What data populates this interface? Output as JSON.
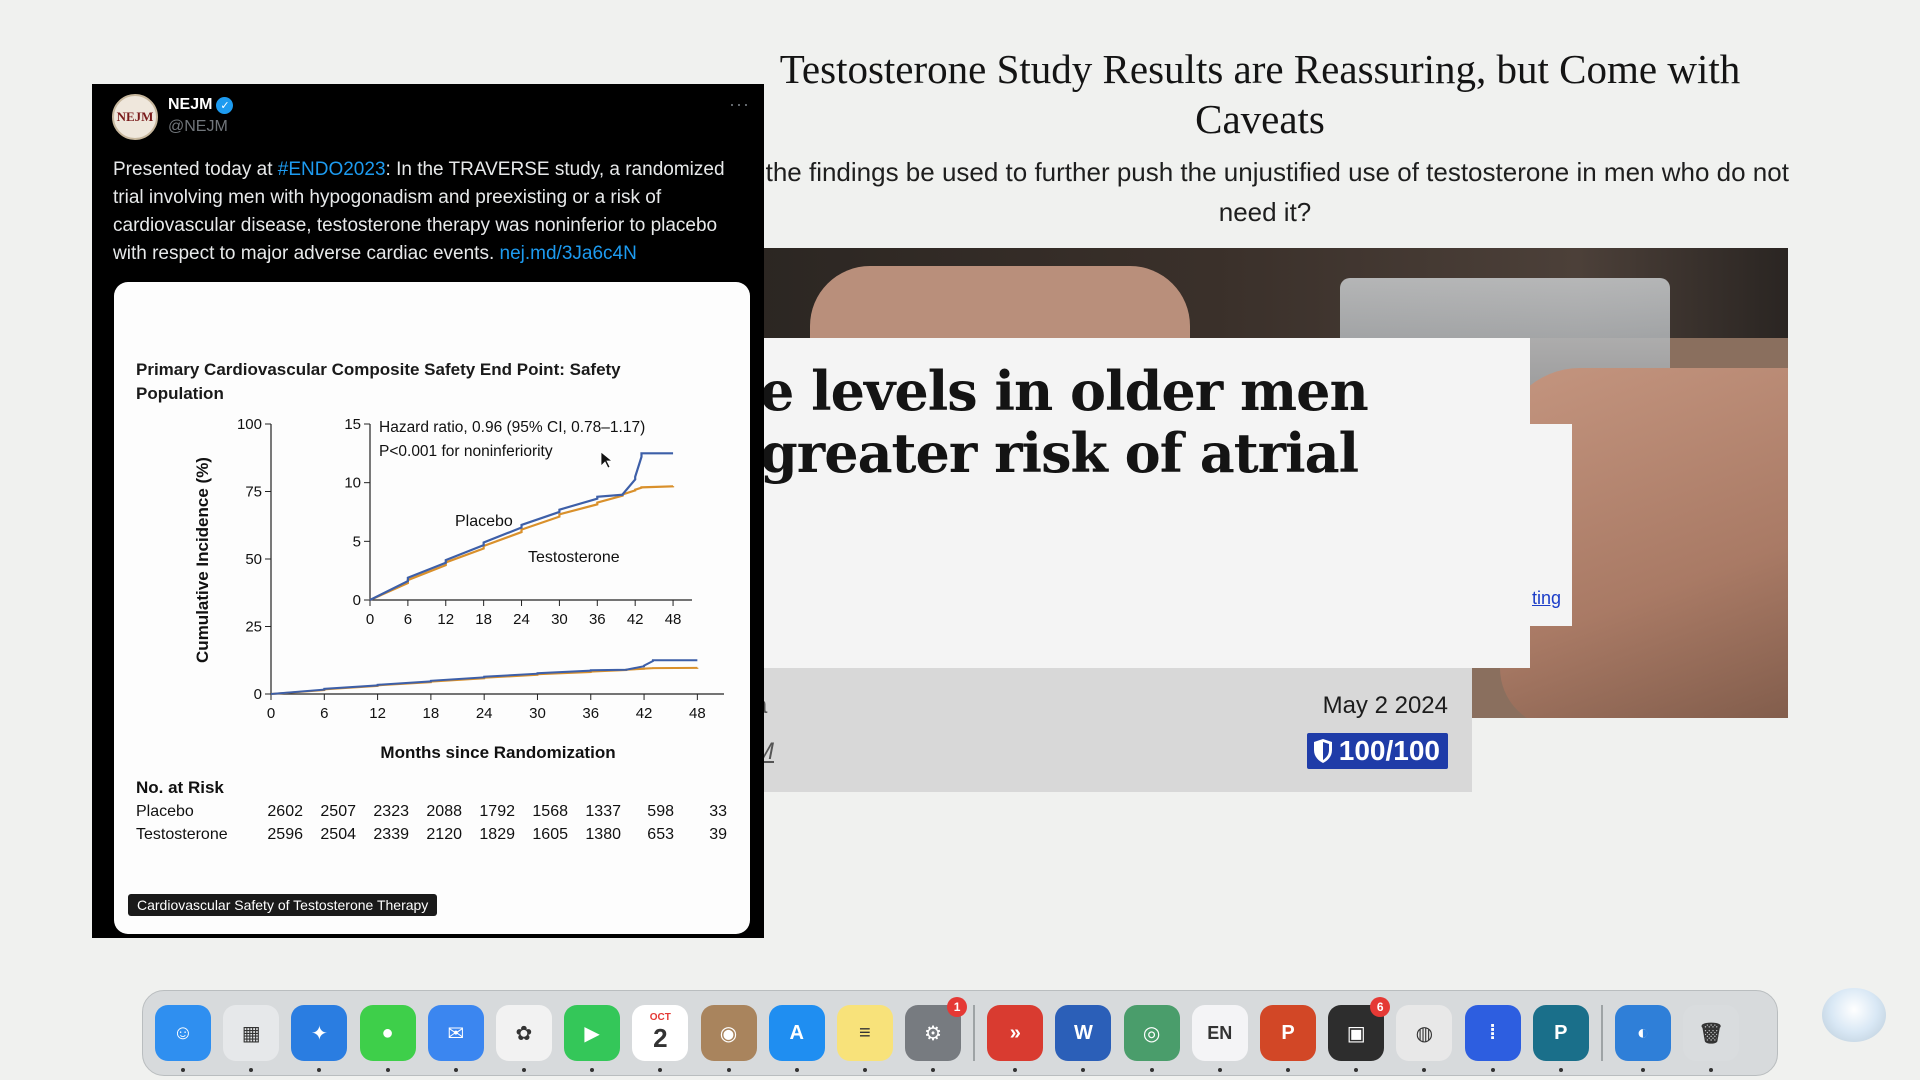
{
  "article": {
    "title": "Testosterone Study Results are Reassuring, but Come with Caveats",
    "subtitle": "ill the findings be used to further push the unjustified use of testosterone in men who do not need it?",
    "embed_headline_line1": "e levels in older men",
    "embed_headline_line2": "greater risk of atrial",
    "embed_link_fragment": "ting",
    "info_fragment_1": "a",
    "info_fragment_2": "M",
    "date": "May 2 2024",
    "score": "100/100"
  },
  "tweet": {
    "avatar_text": "NEJM",
    "name": "NEJM",
    "handle": "@NEJM",
    "more": "···",
    "text_before": "Presented today at ",
    "hashtag": "#ENDO2023",
    "text_main": ": In the TRAVERSE study, a randomized trial involving men with hypogonadism and preexisting or a risk of cardiovascular disease, testosterone therapy was noninferior to placebo with respect to major adverse cardiac events. ",
    "link": "nej.md/3Ja6c4N",
    "caption": "Cardiovascular Safety of Testosterone Therapy"
  },
  "chart_data": {
    "type": "line",
    "title": "Primary Cardiovascular Composite Safety End Point: Safety Population",
    "xlabel": "Months since Randomization",
    "ylabel": "Cumulative Incidence (%)",
    "x_ticks": [
      0,
      6,
      12,
      18,
      24,
      30,
      36,
      42,
      48
    ],
    "y_ticks": [
      0,
      25,
      50,
      75,
      100
    ],
    "xlim": [
      0,
      51
    ],
    "ylim": [
      0,
      100
    ],
    "series": [
      {
        "name": "Placebo",
        "color": "#3d5fa8",
        "x": [
          0,
          6,
          12,
          18,
          24,
          30,
          36,
          40,
          42,
          43,
          48
        ],
        "y": [
          0,
          1.9,
          3.4,
          4.9,
          6.4,
          7.7,
          8.8,
          9.0,
          10.5,
          12.5,
          12.5
        ]
      },
      {
        "name": "Testosterone",
        "color": "#d9902b",
        "x": [
          0,
          6,
          12,
          18,
          24,
          30,
          36,
          40,
          42,
          43,
          48
        ],
        "y": [
          0,
          1.7,
          3.2,
          4.6,
          6.0,
          7.3,
          8.3,
          9.0,
          9.4,
          9.6,
          9.7
        ]
      }
    ],
    "inset": {
      "x_ticks": [
        0,
        6,
        12,
        18,
        24,
        30,
        36,
        42,
        48
      ],
      "y_ticks": [
        0,
        5,
        10,
        15
      ],
      "ylim": [
        0,
        15
      ],
      "annotation_line1": "Hazard ratio, 0.96 (95% CI, 0.78–1.17)",
      "annotation_line2": "P<0.001 for noninferiority",
      "label_placebo": "Placebo",
      "label_testosterone": "Testosterone"
    },
    "no_at_risk": {
      "header": "No. at Risk",
      "rows": [
        {
          "label": "Placebo",
          "values": [
            "2602",
            "2507",
            "2323",
            "2088",
            "1792",
            "1568",
            "1337",
            "598",
            "33"
          ]
        },
        {
          "label": "Testosterone",
          "values": [
            "2596",
            "2504",
            "2339",
            "2120",
            "1829",
            "1605",
            "1380",
            "653",
            "39"
          ]
        }
      ]
    }
  },
  "dock": {
    "items": [
      {
        "name": "finder-icon",
        "color": "#2f8ff0",
        "glyph": "☺"
      },
      {
        "name": "launchpad-icon",
        "color": "#e6e8ea",
        "glyph": "▦"
      },
      {
        "name": "safari-icon",
        "color": "#2a7de1",
        "glyph": "✦"
      },
      {
        "name": "messages-icon",
        "color": "#3ecf4a",
        "glyph": "●"
      },
      {
        "name": "mail-icon",
        "color": "#3b86f0",
        "glyph": "✉"
      },
      {
        "name": "photos-icon",
        "color": "#f2f2f2",
        "glyph": "✿"
      },
      {
        "name": "facetime-icon",
        "color": "#34c759",
        "glyph": "▶"
      },
      {
        "name": "calendar-icon",
        "color": "#ffffff",
        "glyph": "2"
      },
      {
        "name": "contacts-icon",
        "color": "#a9845d",
        "glyph": "◉"
      },
      {
        "name": "app-store-icon",
        "color": "#1f8ef1",
        "glyph": "A"
      },
      {
        "name": "notes-icon",
        "color": "#f8e27a",
        "glyph": "≡"
      },
      {
        "name": "system-settings-icon",
        "color": "#777b80",
        "glyph": "⚙",
        "badge": "1"
      },
      {
        "name": "remote-desktop-icon",
        "color": "#d93b30",
        "glyph": "»"
      },
      {
        "name": "word-icon",
        "color": "#2b5fb8",
        "glyph": "W"
      },
      {
        "name": "network-icon",
        "color": "#4a9d6b",
        "glyph": "◎"
      },
      {
        "name": "language-input-icon",
        "color": "#f4f4f6",
        "glyph": "EN"
      },
      {
        "name": "powerpoint-icon",
        "color": "#d24726",
        "glyph": "P"
      },
      {
        "name": "image-capture-icon",
        "color": "#2d2d2d",
        "glyph": "▣",
        "badge": "6"
      },
      {
        "name": "chrome-icon",
        "color": "#e8e8e8",
        "glyph": "◍"
      },
      {
        "name": "dictation-icon",
        "color": "#2d5ee0",
        "glyph": "⁞"
      },
      {
        "name": "publisher-icon",
        "color": "#1a6f8a",
        "glyph": "P"
      },
      {
        "name": "downloads-stack-icon",
        "color": "#2f7fd8",
        "glyph": "◐"
      },
      {
        "name": "trash-icon",
        "color": "#d9dcde",
        "glyph": "🗑"
      }
    ],
    "calendar_month": "OCT"
  }
}
